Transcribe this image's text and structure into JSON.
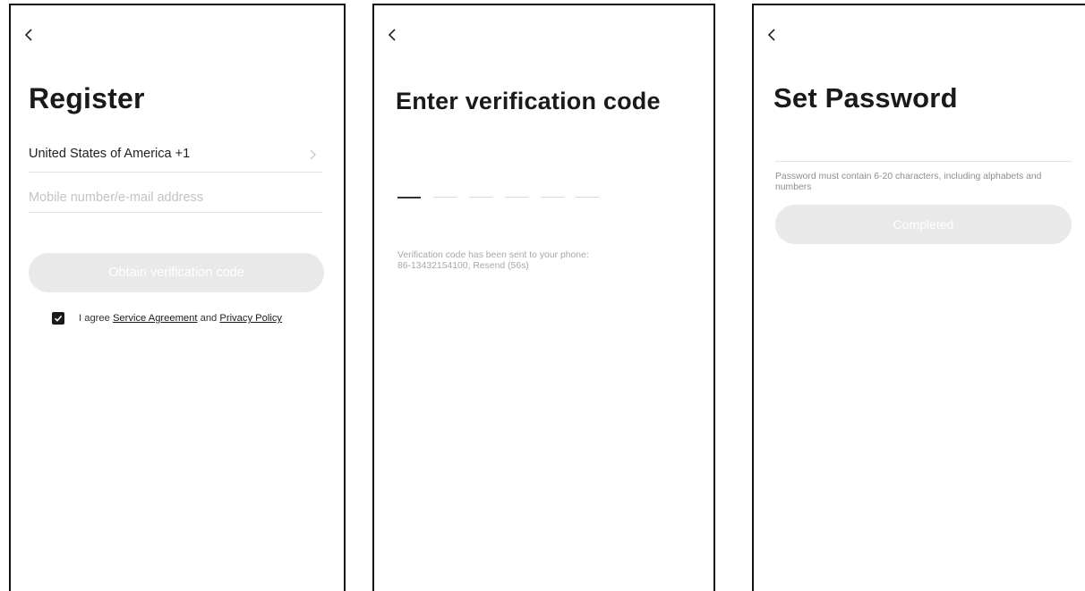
{
  "register": {
    "title": "Register",
    "country": "United States of America +1",
    "account_placeholder": "Mobile number/e-mail address",
    "obtain_button": "Obtain verification code",
    "agree_prefix": "I agree",
    "service_agreement": "Service Agreement",
    "agree_and": "and",
    "privacy_policy": "Privacy Policy",
    "agree_checked": true
  },
  "verify": {
    "title": "Enter verification code",
    "code_length": 6,
    "hint_line1": "Verification code has been sent to your phone:",
    "phone": "86-13432154100",
    "resend": "Resend (56s)"
  },
  "password": {
    "title": "Set Password",
    "hint": "Password must contain 6-20 characters, including alphabets and numbers",
    "complete_button": "Completed"
  },
  "icons": {
    "back": "chevron-left-icon",
    "chevron": "chevron-right-icon",
    "check": "checkmark-icon"
  },
  "colors": {
    "button_disabled": "#e9e9e9",
    "frame": "#111111",
    "hint": "#a8a8a8",
    "divider": "#e2e2e2"
  }
}
